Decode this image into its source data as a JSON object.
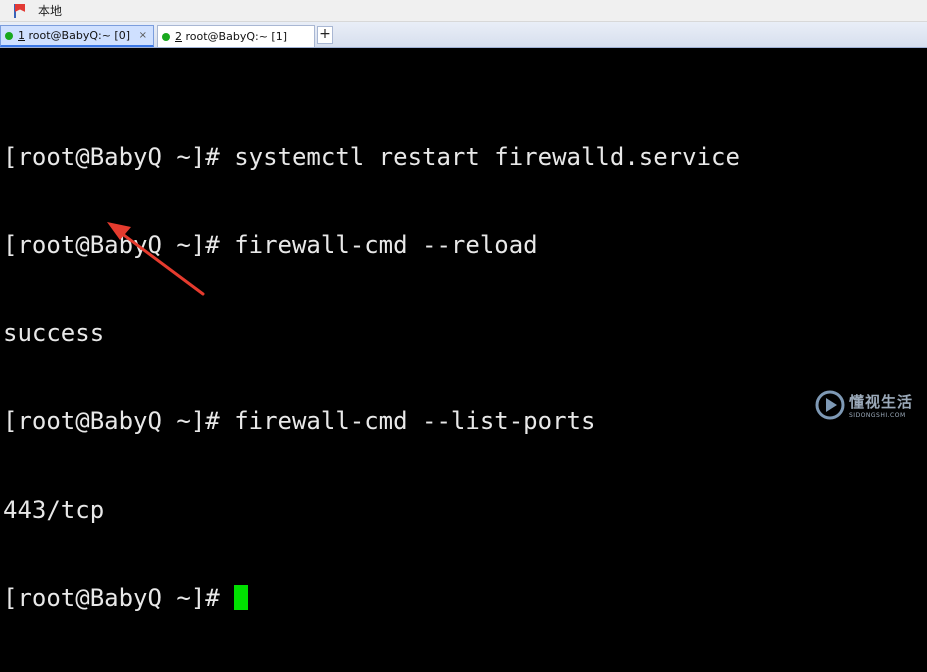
{
  "topbar": {
    "location_label": "本地",
    "icon": "bookmark-flag-icon"
  },
  "tabs": [
    {
      "number": "1",
      "title": " root@BabyQ:~ [0]",
      "active": true,
      "status_color": "#19a81e"
    },
    {
      "number": "2",
      "title": " root@BabyQ:~ [1]",
      "active": false,
      "status_color": "#19a81e"
    }
  ],
  "new_tab_label": "+",
  "close_glyph": "×",
  "terminal": {
    "lines": [
      "[root@BabyQ ~]# systemctl restart firewalld.service",
      "[root@BabyQ ~]# firewall-cmd --reload",
      "success",
      "[root@BabyQ ~]# firewall-cmd --list-ports",
      "443/tcp",
      "[root@BabyQ ~]#"
    ],
    "text_color": "#e8e8e8",
    "cursor_color": "#00e000",
    "background": "#000000"
  },
  "annotation": {
    "type": "arrow",
    "color": "#e53b2e"
  },
  "watermark": {
    "main": "懂视生活",
    "sub": "SIDONGSHI.COM"
  }
}
